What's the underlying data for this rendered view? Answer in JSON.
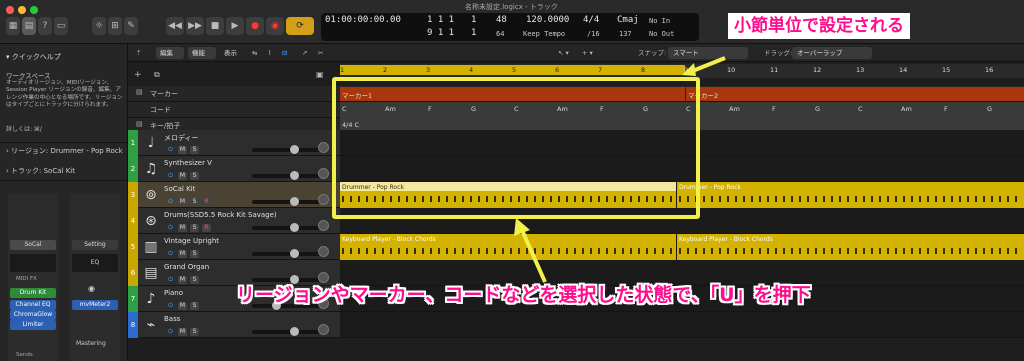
{
  "window": {
    "title": "名称未設定.logicx - トラック"
  },
  "toolbar": {
    "buttons": [
      "library-icon",
      "inspector-icon",
      "help-icon",
      "toolbar-icon",
      "smart-controls-icon",
      "mixer-icon",
      "editors-icon"
    ]
  },
  "transport": {
    "position_time": "01:00:00:00.00",
    "position_bars_top": "1  1  1",
    "end_top": "1",
    "position_bars_bottom": "9  1  1",
    "end_bottom": "1",
    "division_top": "48",
    "division_bottom": "64",
    "tempo": "120.0000",
    "tempo_mode": "Keep Tempo",
    "signature": "4/4",
    "signature_division": "/16",
    "key": "Cmaj",
    "key_value": "137",
    "input_in": "No In",
    "input_out": "No Out"
  },
  "subbar": {
    "edit": "編集",
    "function": "機能",
    "view": "表示",
    "snap_label": "スナップ:",
    "snap_value": "スマート",
    "drag_label": "ドラッグ:",
    "drag_value": "オーバーラップ"
  },
  "quickhelp": {
    "title": "クイックヘルプ",
    "heading": "ワークスペース",
    "body": "オーディオリージョン、MIDIリージョン、Session Player リージョンの録音、編集、アレンジ作業の中心となる場所です。リージョンはタイプごとにトラックに分けられます。",
    "more": "詳しくは: ⌘/"
  },
  "inspector": {
    "region_label": "リージョン: Drummer - Pop Rock",
    "track_label": "トラック: SoCal Kit",
    "strip1_name": "SoCal",
    "strip1_fx": "MIDI FX",
    "strip1_instrument": "Drum Kit",
    "strip1_eq": "Channel EQ",
    "strip1_plugin2": "ChromaGlow",
    "strip1_plugin3": "Limiter",
    "strip1_sends": "Sends",
    "strip2_setting": "Setting",
    "strip2_eq": "EQ",
    "strip2_plugin": "mvMeter2",
    "strip2_name": "Mastering"
  },
  "ruler": {
    "bars": [
      "1",
      "2",
      "3",
      "4",
      "5",
      "6",
      "7",
      "8",
      "9",
      "10",
      "11",
      "12",
      "13",
      "14",
      "15",
      "16"
    ]
  },
  "global_tracks": {
    "marker_label": "マーカー",
    "chord_label": "コード",
    "key_label": "キー/拍子",
    "marker1": "マーカー1",
    "marker2": "マーカー2",
    "chords": [
      "C",
      "Am",
      "F",
      "G",
      "C",
      "Am",
      "F",
      "G",
      "C",
      "Am",
      "F",
      "G",
      "C",
      "Am",
      "F",
      "G"
    ],
    "key_sig": "4/4 C"
  },
  "tracks": [
    {
      "num": "1",
      "name": "メロディー",
      "icon": "music-note-icon",
      "color": "#2ea043"
    },
    {
      "num": "2",
      "name": "Synthesizer V",
      "icon": "note-icon",
      "color": "#2ea043"
    },
    {
      "num": "3",
      "name": "SoCal Kit",
      "icon": "drum-kit-icon",
      "color": "#c9a600"
    },
    {
      "num": "4",
      "name": "Drums(SSD5.5 Rock Kit Savage)",
      "icon": "drums-icon",
      "color": "#c9a600"
    },
    {
      "num": "5",
      "name": "Vintage Upright",
      "icon": "piano-icon",
      "color": "#c9a600"
    },
    {
      "num": "6",
      "name": "Grand Organ",
      "icon": "organ-icon",
      "color": "#c9a600"
    },
    {
      "num": "7",
      "name": "Piano",
      "icon": "grand-piano-icon",
      "color": "#2ea043"
    },
    {
      "num": "8",
      "name": "Bass",
      "icon": "bass-icon",
      "color": "#2d6bd1"
    }
  ],
  "regions": {
    "drummer": "Drummer - Pop Rock",
    "keyboard": "Keyboard Player - Block Chords"
  },
  "annotations": {
    "top": "小節単位で設定される",
    "bottom": "リージョンやマーカー、コードなどを選択した状態で、「U」を押下"
  },
  "colors": {
    "accent": "#ff0d8c",
    "highlight": "#f3f04a",
    "region": "#d4b200"
  }
}
